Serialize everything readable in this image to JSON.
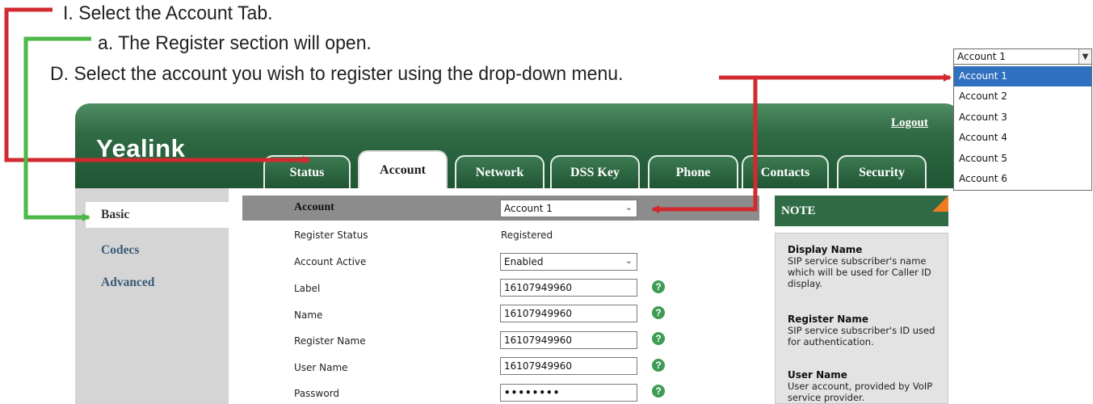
{
  "instructions": {
    "step1": "I.  Select the Account Tab.",
    "step2": "a.  The Register section will open.",
    "step3": "D.  Select the account you wish to register using the drop-down menu."
  },
  "header": {
    "logo": "Yealink",
    "logout": "Logout",
    "tabs": [
      {
        "label": "Status",
        "active": false
      },
      {
        "label": "Account",
        "active": true
      },
      {
        "label": "Network",
        "active": false
      },
      {
        "label": "DSS Key",
        "active": false
      },
      {
        "label": "Phone",
        "active": false
      },
      {
        "label": "Contacts",
        "active": false
      },
      {
        "label": "Security",
        "active": false
      }
    ]
  },
  "sidebar": {
    "items": [
      {
        "label": "Basic",
        "active": true
      },
      {
        "label": "Codecs",
        "active": false
      },
      {
        "label": "Advanced",
        "active": false
      }
    ]
  },
  "form": {
    "account_label": "Account",
    "account_value": "Account 1",
    "rows": [
      {
        "label": "Register Status",
        "value": "Registered"
      },
      {
        "label": "Account Active",
        "value": "Enabled"
      },
      {
        "label": "Label",
        "value": "16107949960",
        "help": "?"
      },
      {
        "label": "Name",
        "value": "16107949960",
        "help": "?"
      },
      {
        "label": "Register Name",
        "value": "16107949960",
        "help": "?"
      },
      {
        "label": "User Name",
        "value": "16107949960",
        "help": "?"
      },
      {
        "label": "Password",
        "value": "••••••••",
        "help": "?"
      }
    ]
  },
  "note": {
    "title": "NOTE",
    "sections": [
      {
        "title": "Display Name",
        "text": "SIP service subscriber's name which will be used for Caller ID display."
      },
      {
        "title": "Register Name",
        "text": "SIP service subscriber's ID used for authentication."
      },
      {
        "title": "User Name",
        "text": "User account, provided by VoIP service provider."
      }
    ]
  },
  "dropdown": {
    "selected": "Account 1",
    "options": [
      "Account 1",
      "Account 2",
      "Account 3",
      "Account 4",
      "Account 5",
      "Account 6"
    ],
    "highlighted": "Account 1"
  },
  "colors": {
    "red_arrow": "#d12a2f",
    "green_arrow": "#4db848",
    "header_green": "#2f6b44",
    "note_corner": "#ef7a1f",
    "highlight_blue": "#3070c0"
  }
}
